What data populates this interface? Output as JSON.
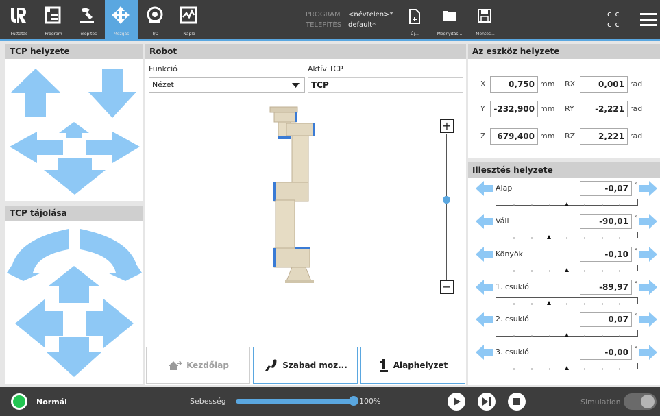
{
  "header": {
    "nav": [
      {
        "label": "Futtatás",
        "icon": "ur-logo-icon"
      },
      {
        "label": "Program",
        "icon": "program-icon"
      },
      {
        "label": "Telepítés",
        "icon": "installation-icon"
      },
      {
        "label": "Mozgás",
        "icon": "move-icon",
        "active": true
      },
      {
        "label": "I/O",
        "icon": "io-icon"
      },
      {
        "label": "Napló",
        "icon": "log-icon"
      }
    ],
    "program_key": "PROGRAM",
    "program_value": "<névtelen>*",
    "install_key": "TELEPÍTÉS",
    "install_value": "default*",
    "file": [
      {
        "label": "Új...",
        "icon": "new-file-icon"
      },
      {
        "label": "Megnyitás...",
        "icon": "open-folder-icon"
      },
      {
        "label": "Mentés...",
        "icon": "save-icon"
      }
    ],
    "cc_top": "c c",
    "cc_bottom": "c c"
  },
  "tcp_position": {
    "title": "TCP helyzete"
  },
  "tcp_orientation": {
    "title": "TCP tájolása"
  },
  "robot": {
    "title": "Robot",
    "function_label": "Funkció",
    "function_value": "Nézet",
    "active_tcp_label": "Aktív TCP",
    "active_tcp_value": "TCP",
    "zoom_in": "+",
    "zoom_out": "−",
    "zoom_level": 0.55,
    "buttons": {
      "home": "Kezdőlap",
      "freedrive": "Szabad moz...",
      "zero": "Alaphelyzet"
    }
  },
  "tool_position": {
    "title": "Az eszköz helyzete",
    "rows": [
      {
        "axis": "X",
        "value": "0,750",
        "unit": "mm",
        "raxis": "RX",
        "rvalue": "0,001",
        "runit": "rad"
      },
      {
        "axis": "Y",
        "value": "-232,900",
        "unit": "mm",
        "raxis": "RY",
        "rvalue": "-2,221",
        "runit": "rad"
      },
      {
        "axis": "Z",
        "value": "679,400",
        "unit": "mm",
        "raxis": "RZ",
        "rvalue": "2,221",
        "runit": "rad"
      }
    ]
  },
  "joints": {
    "title": "Illesztés helyzete",
    "degree_symbol": "°",
    "items": [
      {
        "name": "Alap",
        "value": "-0,07",
        "position": 0.5
      },
      {
        "name": "Váll",
        "value": "-90,01",
        "position": 0.375
      },
      {
        "name": "Könyök",
        "value": "-0,10",
        "position": 0.5
      },
      {
        "name": "1. csukló",
        "value": "-89,97",
        "position": 0.375
      },
      {
        "name": "2. csukló",
        "value": "0,07",
        "position": 0.5
      },
      {
        "name": "3. csukló",
        "value": "-0,00",
        "position": 0.5
      }
    ]
  },
  "footer": {
    "status": "Normál",
    "speed_label": "Sebesség",
    "speed_value": "100%",
    "speed_fraction": 1.0,
    "simulation_label": "Simulation"
  },
  "colors": {
    "accent": "#5aa7e0",
    "arrow": "#8ec8f5",
    "bar": "#3d3d3d",
    "status_green": "#23c552"
  }
}
